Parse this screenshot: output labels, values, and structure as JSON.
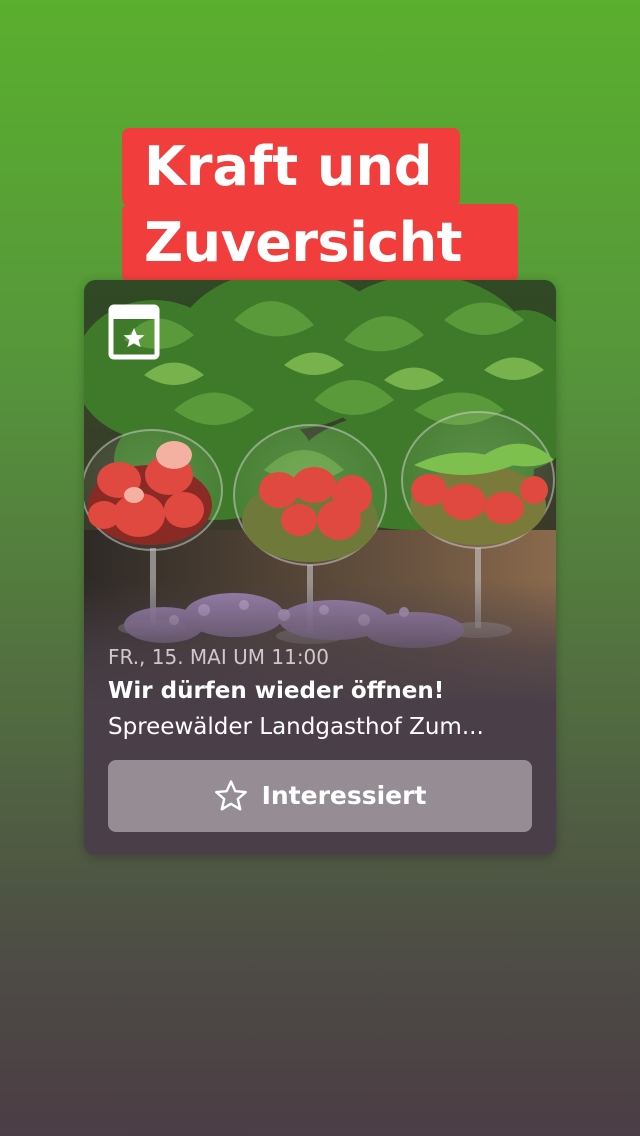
{
  "story": {
    "headline_line1": "Kraft und",
    "headline_line2": "Zuversicht",
    "background_top_color": "#5aaf2e",
    "background_bottom_color": "#4b3d45",
    "headline_color": "#f23d3d"
  },
  "event_card": {
    "icon": "calendar-star-icon",
    "image": "strawberry-drinks-in-glasses-with-mint",
    "date": "FR., 15. MAI UM 11:00",
    "title": "Wir dürfen wieder öffnen!",
    "location": "Spreewälder Landgasthof Zum...",
    "interested_button": {
      "icon": "star-outline-icon",
      "label": "Interessiert"
    }
  }
}
